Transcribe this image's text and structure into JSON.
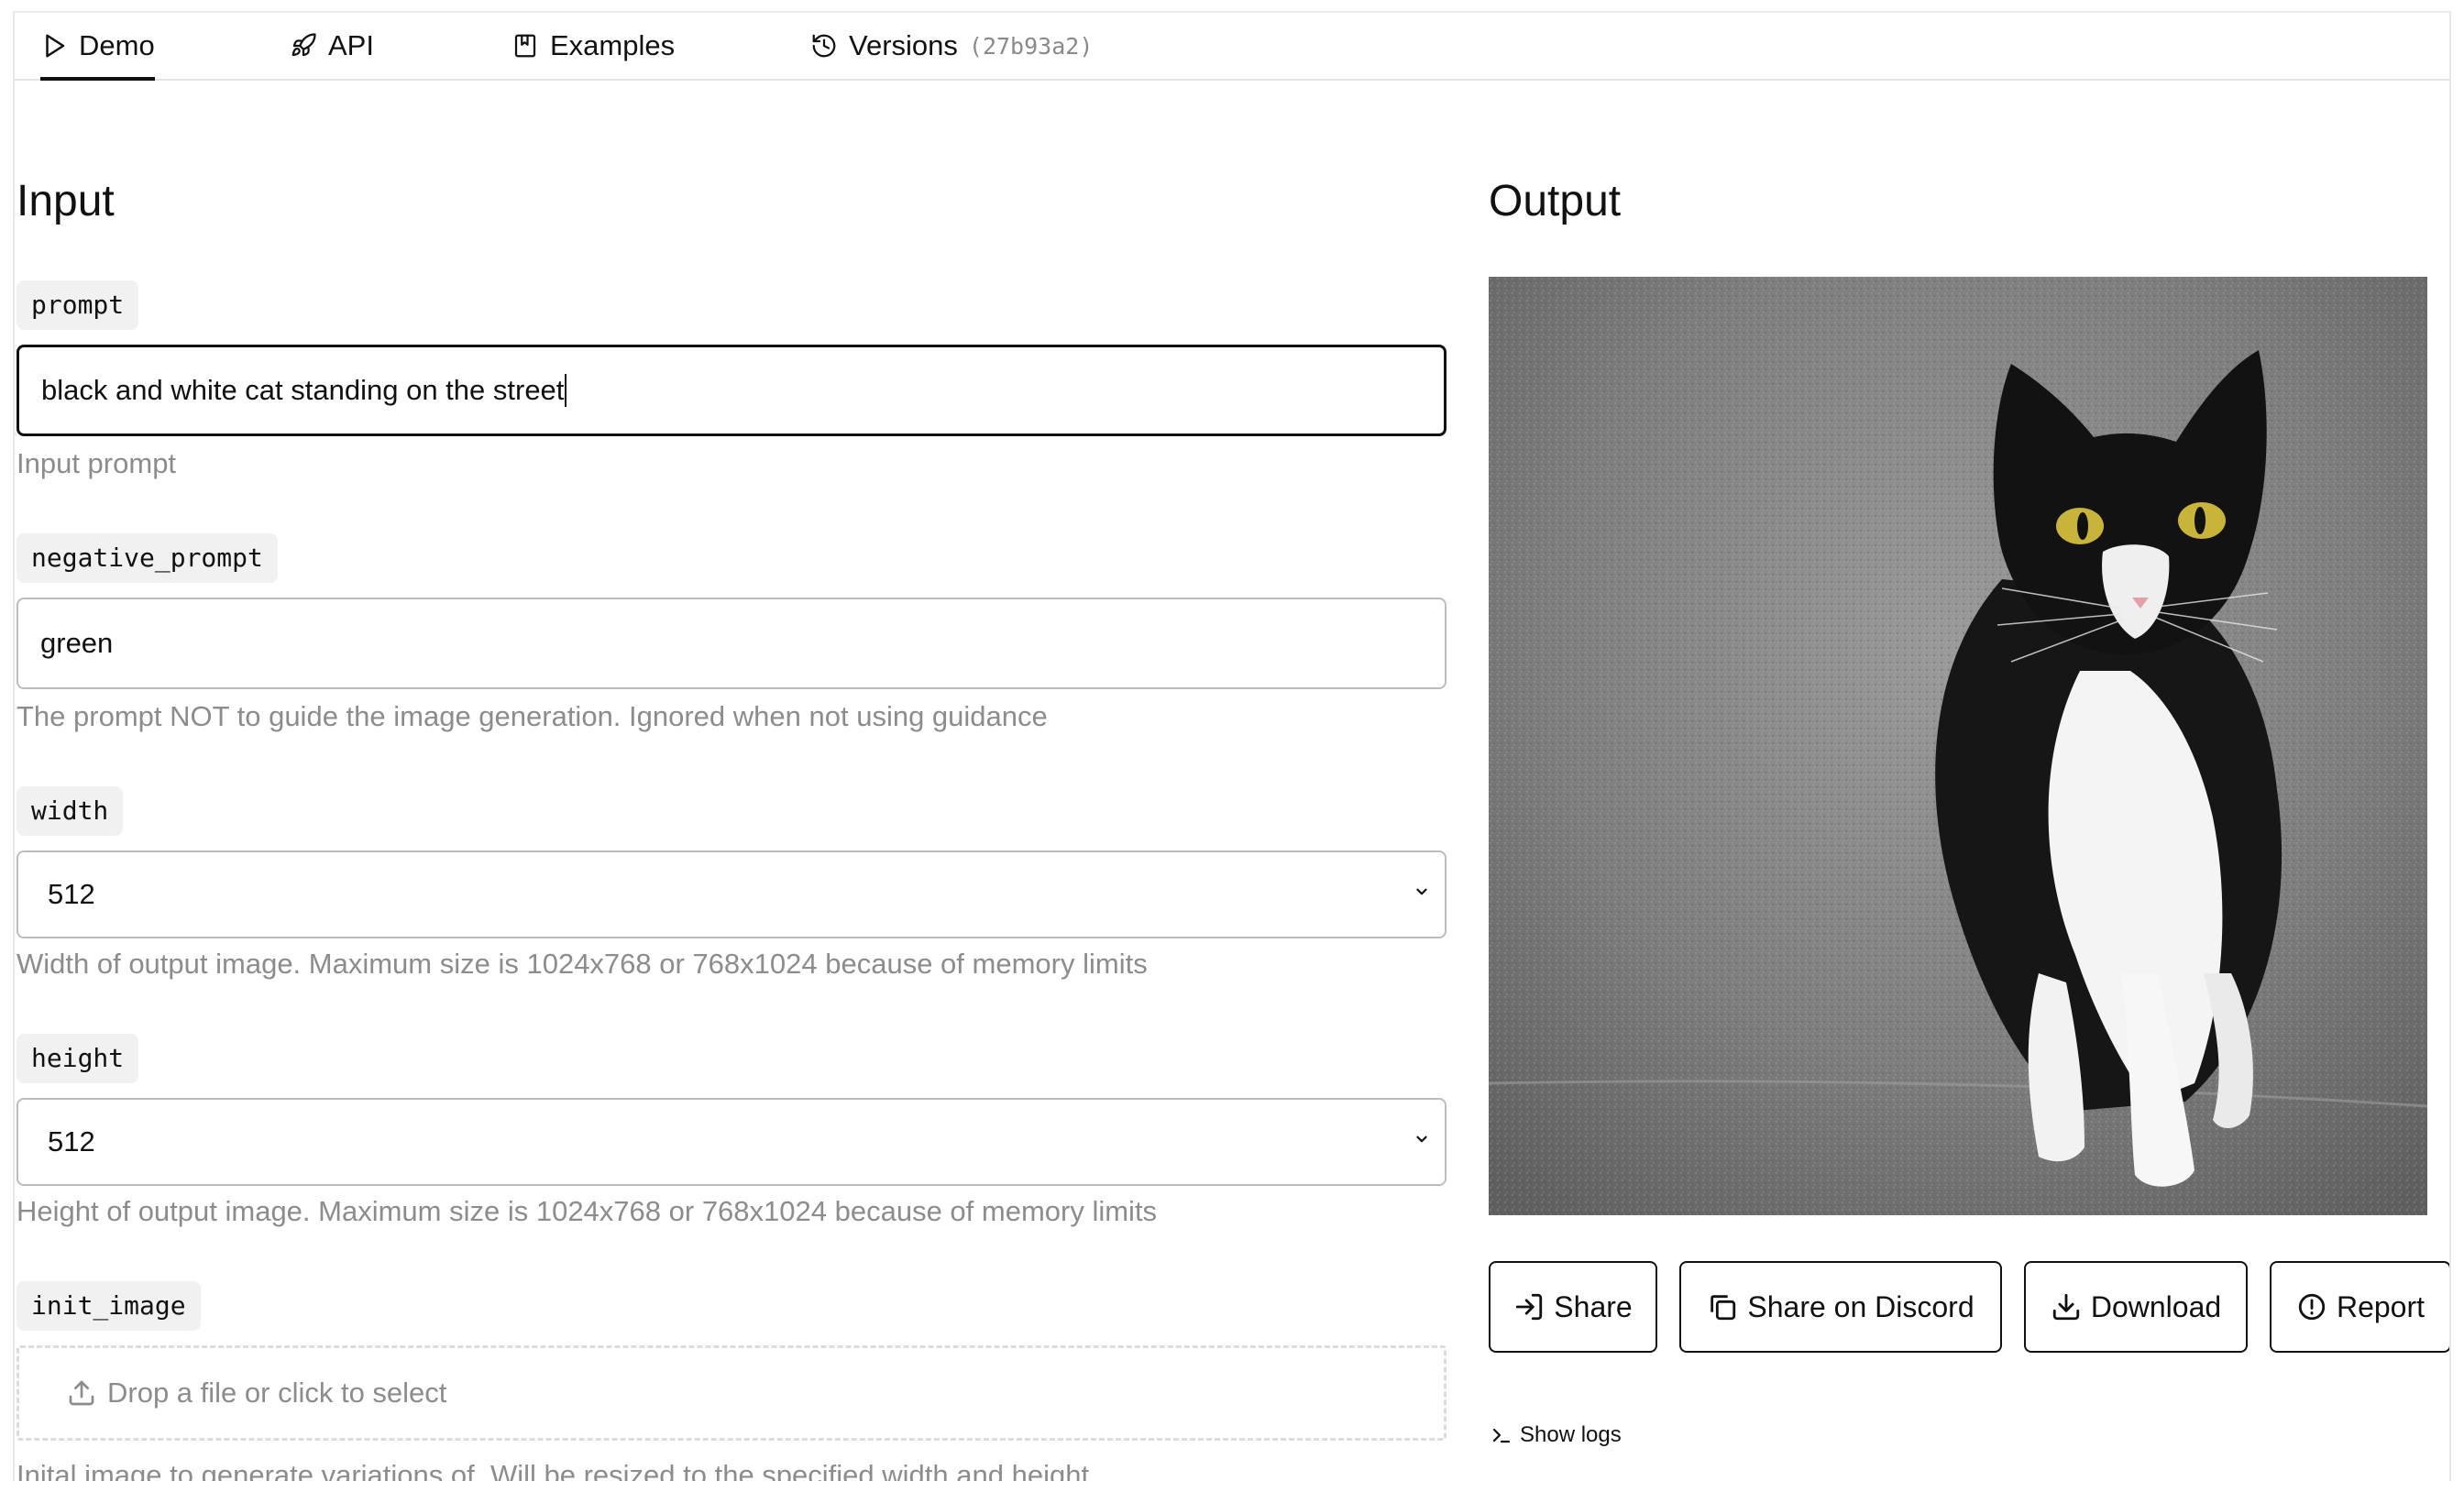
{
  "tabs": [
    {
      "label": "Demo",
      "icon": "play-icon",
      "active": true
    },
    {
      "label": "API",
      "icon": "rocket-icon"
    },
    {
      "label": "Examples",
      "icon": "bookmark-icon"
    },
    {
      "label": "Versions",
      "icon": "history-icon",
      "hash": "(27b93a2)"
    }
  ],
  "input": {
    "heading": "Input",
    "prompt": {
      "label": "prompt",
      "value": "black and white cat standing on the street",
      "help": "Input prompt"
    },
    "negative_prompt": {
      "label": "negative_prompt",
      "value": "green",
      "help": "The prompt NOT to guide the image generation. Ignored when not using guidance"
    },
    "width": {
      "label": "width",
      "value": "512",
      "help": "Width of output image. Maximum size is 1024x768 or 768x1024 because of memory limits"
    },
    "height": {
      "label": "height",
      "value": "512",
      "help": "Height of output image. Maximum size is 1024x768 or 768x1024 because of memory limits"
    },
    "init_image": {
      "label": "init_image",
      "placeholder": "Drop a file or click to select",
      "help": "Inital image to generate variations of. Will be resized to the specified width and height"
    }
  },
  "output": {
    "heading": "Output",
    "image_subject": "black and white cat standing on the street",
    "buttons": {
      "share": "Share",
      "discord": "Share on Discord",
      "download": "Download",
      "report": "Report"
    },
    "show_logs": "Show logs"
  }
}
